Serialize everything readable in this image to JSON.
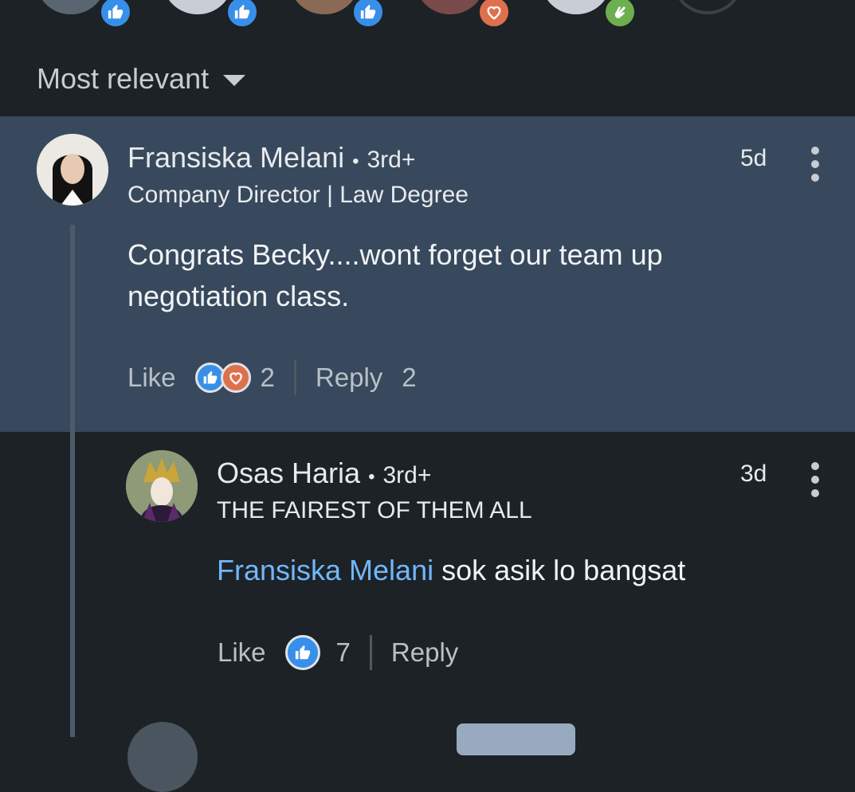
{
  "reactors": [
    {
      "reaction": "like-icon"
    },
    {
      "reaction": "like-icon"
    },
    {
      "reaction": "like-icon"
    },
    {
      "reaction": "love-icon"
    },
    {
      "reaction": "clap-icon"
    }
  ],
  "sort": {
    "label": "Most relevant"
  },
  "comments": [
    {
      "name": "Fransiska Melani",
      "degree": "3rd+",
      "headline": "Company Director | Law Degree",
      "time": "5d",
      "text": "Congrats Becky....wont forget our team up negotiation class.",
      "like_label": "Like",
      "reaction_count": "2",
      "reply_label": "Reply",
      "reply_count": "2"
    },
    {
      "name": "Osas Haria",
      "degree": "3rd+",
      "headline": "THE FAIREST OF THEM ALL",
      "time": "3d",
      "mention": "Fransiska Melani",
      "text": "sok asik lo bangsat",
      "like_label": "Like",
      "reaction_count": "7",
      "reply_label": "Reply"
    }
  ],
  "colors": {
    "background": "#1d2226",
    "highlight": "#38495d",
    "like": "#378fe9",
    "love": "#df704d",
    "mention": "#71b7fb"
  }
}
